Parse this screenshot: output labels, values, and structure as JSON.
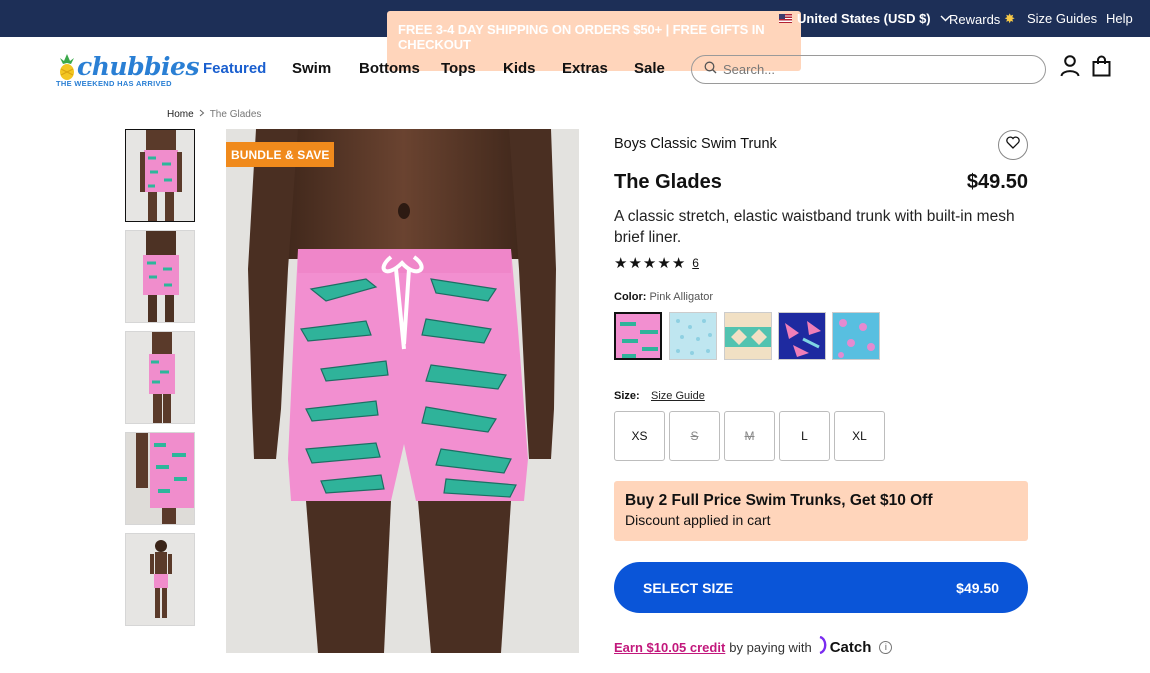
{
  "topbar": {
    "promo": "FREE 3-4 DAY SHIPPING ON ORDERS $50+ | FREE GIFTS IN CHECKOUT",
    "region": "United States (USD $)",
    "rewards": "Rewards",
    "size_guides": "Size Guides",
    "help": "Help",
    "bg_color": "#1d2f57"
  },
  "header": {
    "logo_text": "chubbies",
    "logo_tagline": "THE WEEKEND HAS ARRIVED",
    "nav": [
      "Featured",
      "Swim",
      "Bottoms",
      "Tops",
      "Kids",
      "Extras",
      "Sale"
    ],
    "active_nav": "Featured",
    "search_placeholder": "Search...",
    "icons": [
      "search-icon",
      "account-icon",
      "cart-icon"
    ]
  },
  "breadcrumb": [
    "Home",
    "The Glades"
  ],
  "gallery": {
    "badge": "BUNDLE & SAVE",
    "thumbnail_count": 5,
    "selected_thumbnail": 1
  },
  "product": {
    "subtitle": "Boys Classic Swim Trunk",
    "title": "The Glades",
    "price": "$49.50",
    "description": "A classic stretch, elastic waistband trunk with built-in mesh brief liner.",
    "rating_stars": 5,
    "review_count": "6",
    "color_label": "Color:",
    "color_value": "Pink Alligator",
    "swatches": [
      "Pink Alligator",
      "Light Blue Pattern",
      "Aztec Teal",
      "Navy Tropical",
      "Blue Floral"
    ],
    "size_label": "Size:",
    "size_guide": "Size Guide",
    "sizes": [
      {
        "label": "XS",
        "available": true
      },
      {
        "label": "S",
        "available": false
      },
      {
        "label": "M",
        "available": false
      },
      {
        "label": "L",
        "available": true
      },
      {
        "label": "XL",
        "available": true
      }
    ],
    "promo_heading": "Buy 2 Full Price Swim Trunks, Get $10 Off",
    "promo_sub": "Discount applied in cart",
    "cta_label": "SELECT SIZE",
    "cta_price": "$49.50",
    "catch_earn": "Earn $10.05 credit",
    "catch_by": "by paying with",
    "catch_brand": "Catch",
    "accent_color": "#0a55d8",
    "promo_color": "#ffd5bb"
  }
}
